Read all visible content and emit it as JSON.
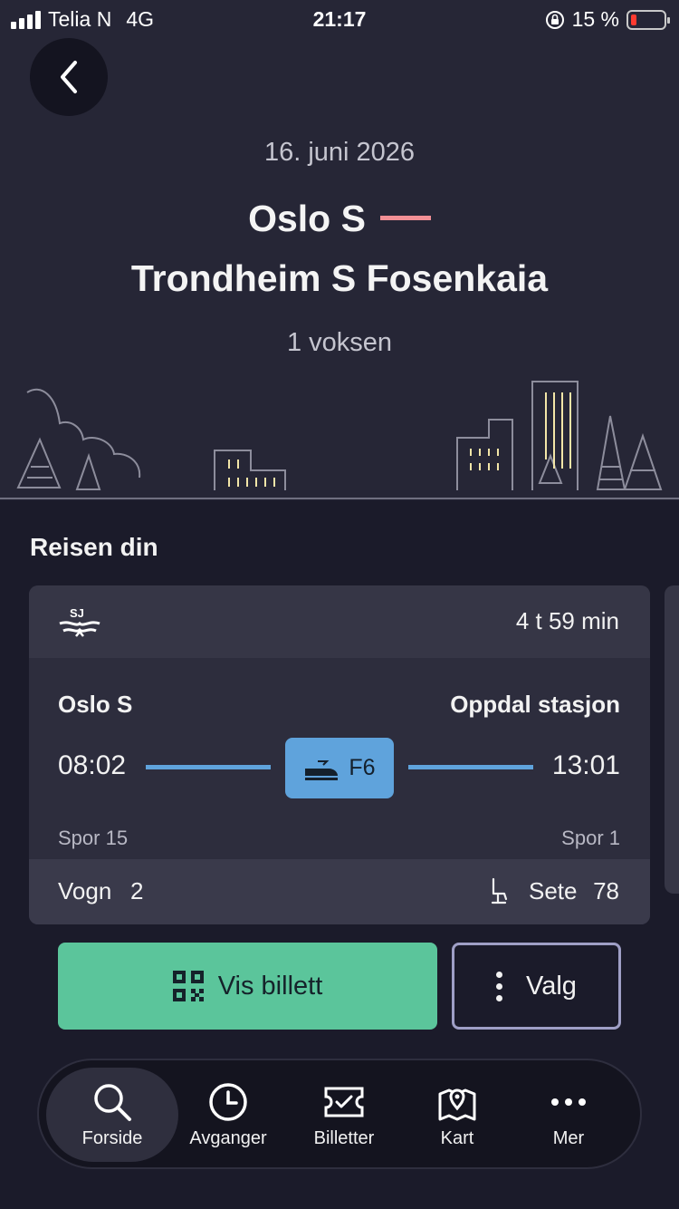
{
  "status_bar": {
    "carrier": "Telia N",
    "network": "4G",
    "time": "21:17",
    "battery": "15 %"
  },
  "trip": {
    "date": "16. juni 2026",
    "from": "Oslo S",
    "to": "Trondheim S Fosenkaia",
    "passengers": "1 voksen"
  },
  "section_title": "Reisen din",
  "leg": {
    "operator_logo": "sj-logo",
    "duration": "4 t 59 min",
    "from_station": "Oslo S",
    "to_station": "Oppdal stasjon",
    "departure_time": "08:02",
    "arrival_time": "13:01",
    "departure_track": "Spor 15",
    "arrival_track": "Spor 1",
    "train_line": "F6",
    "line_color": "#5fa3dc",
    "coach_label": "Vogn",
    "coach": "2",
    "seat_label": "Sete",
    "seat": "78"
  },
  "actions": {
    "show_ticket": "Vis billett",
    "options": "Valg",
    "accent": "#5bc59b"
  },
  "tabs": [
    {
      "label": "Forside",
      "icon": "search-icon",
      "active": true
    },
    {
      "label": "Avganger",
      "icon": "clock-icon"
    },
    {
      "label": "Billetter",
      "icon": "ticket-icon"
    },
    {
      "label": "Kart",
      "icon": "map-icon"
    },
    {
      "label": "Mer",
      "icon": "more-icon"
    }
  ]
}
